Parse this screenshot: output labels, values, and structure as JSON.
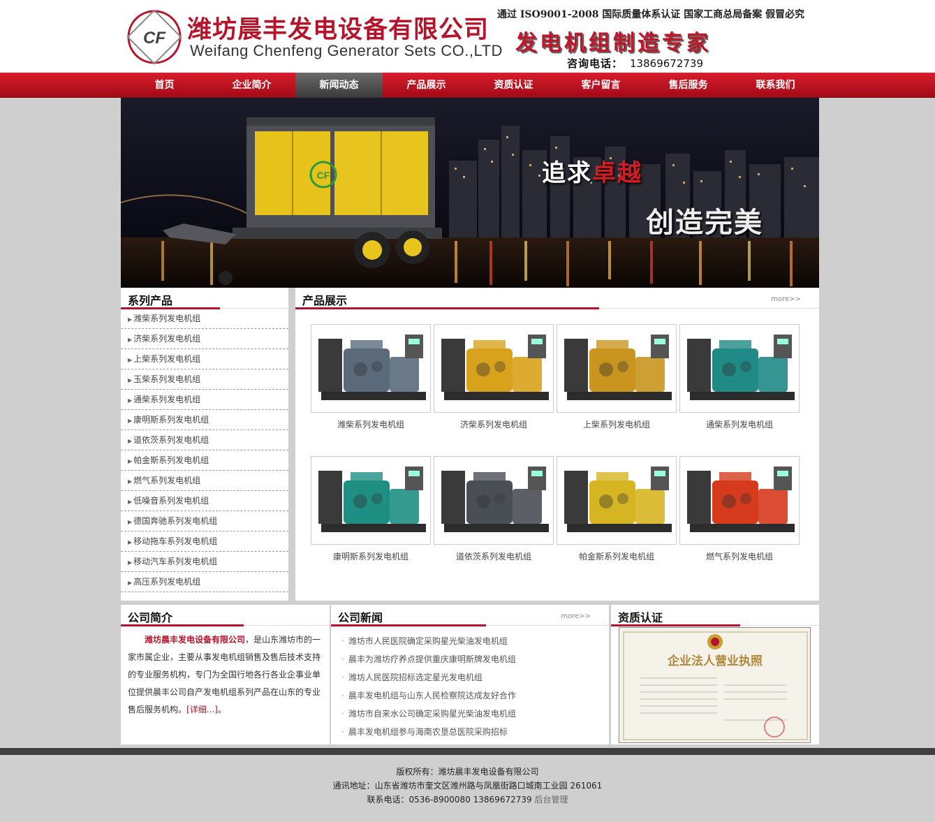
{
  "header": {
    "company_cn": "潍坊晨丰发电设备有限公司",
    "company_en": "Weifang Chenfeng Generator Sets CO.,LTD",
    "cert_line": "通过 ISO9001-2008 国际质量体系认证   国家工商总局备案  假冒必究",
    "slogan": "发电机组制造专家",
    "phone_label": "咨询电话：",
    "phone_number": "13869672739",
    "logo_text": "CF"
  },
  "nav": {
    "items": [
      {
        "label": "首页",
        "active": false
      },
      {
        "label": "企业简介",
        "active": false
      },
      {
        "label": "新闻动态",
        "active": true
      },
      {
        "label": "产品展示",
        "active": false
      },
      {
        "label": "资质认证",
        "active": false
      },
      {
        "label": "客户留言",
        "active": false
      },
      {
        "label": "售后服务",
        "active": false
      },
      {
        "label": "联系我们",
        "active": false
      }
    ]
  },
  "banner": {
    "line1_a": "追求",
    "line1_b": "卓越",
    "line2": "创造完美",
    "logo_text": "CF"
  },
  "sidebar": {
    "title": "系列产品",
    "items": [
      "潍柴系列发电机组",
      "济柴系列发电机组",
      "上柴系列发电机组",
      "玉柴系列发电机组",
      "通柴系列发电机组",
      "康明斯系列发电机组",
      "道依茨系列发电机组",
      "帕金斯系列发电机组",
      "燃气系列发电机组",
      "低噪音系列发电机组",
      "德国奔驰系列发电机组",
      "移动拖车系列发电机组",
      "移动汽车系列发电机组",
      "高压系列发电机组"
    ]
  },
  "products": {
    "title": "产品展示",
    "more": "more>>",
    "items": [
      {
        "label": "潍柴系列发电机组",
        "color": "#5a6a7a"
      },
      {
        "label": "济柴系列发电机组",
        "color": "#d9a21c"
      },
      {
        "label": "上柴系列发电机组",
        "color": "#c9951e"
      },
      {
        "label": "通柴系列发电机组",
        "color": "#1f8a86"
      },
      {
        "label": "康明斯系列发电机组",
        "color": "#1f8f84"
      },
      {
        "label": "道依茨系列发电机组",
        "color": "#4a4f55"
      },
      {
        "label": "帕金斯系列发电机组",
        "color": "#d6b522"
      },
      {
        "label": "燃气系列发电机组",
        "color": "#d63a1c"
      }
    ]
  },
  "intro": {
    "title": "公司简介",
    "company": "潍坊晨丰发电设备有限公司",
    "text": "，是山东潍坊市的一家市属企业，主要从事发电机组销售及售后技术支持的专业服务机构，专门为全国行地各行各业企事业单位提供晨丰公司自产发电机组系列产品在山东的专业售后服务机构。",
    "detail": "[详细...]",
    "tail": "。"
  },
  "news": {
    "title": "公司新闻",
    "more": "more>>",
    "items": [
      "潍坊市人民医院确定采购星光柴油发电机组",
      "晨丰为潍坊疗养点提供重庆康明斯牌发电机组",
      "潍坊人民医院招标选定星光发电机组",
      "晨丰发电机组与山东人民检察院达成友好合作",
      "潍坊市自来水公司确定采购星光柴油发电机组",
      "晨丰发电机组参与海南农垦总医院采购招标"
    ]
  },
  "cert": {
    "title": "资质认证",
    "doc_title": "企业法人营业执照"
  },
  "footer": {
    "copyright": "版权所有：潍坊晨丰发电设备有限公司",
    "address": "通讯地址：山东省潍坊市奎文区潍州路与凤凰街路口城南工业园 261061",
    "phone": "联系电话：0536-8900080 13869672739",
    "admin": "后台管理"
  },
  "colors": {
    "brand_red": "#b5142a",
    "nav_active": "#4a4a4a",
    "page_bg": "#cfcfcf"
  }
}
